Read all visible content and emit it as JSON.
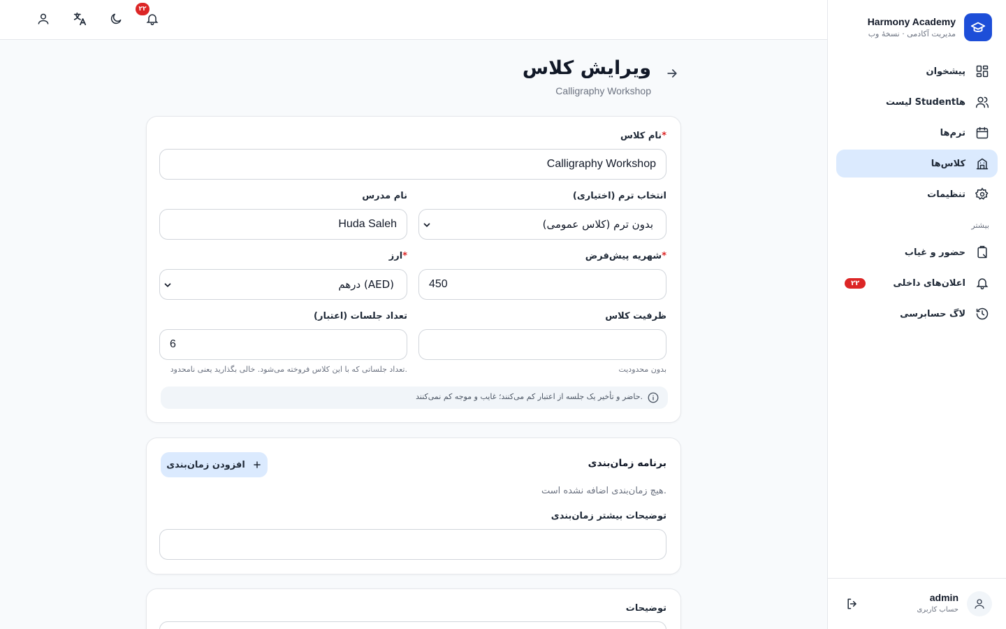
{
  "brand": {
    "name": "Harmony Academy",
    "subtitle": "مدیریت آکادمی · نسخهٔ وب"
  },
  "nav": {
    "items": [
      {
        "label": "پیشخوان",
        "icon": "dashboard-icon"
      },
      {
        "label": "لیست Studentها",
        "icon": "users-icon"
      },
      {
        "label": "ترم‌ها",
        "icon": "calendar-icon"
      },
      {
        "label": "کلاس‌ها",
        "icon": "school-icon",
        "active": true
      },
      {
        "label": "تنظیمات",
        "icon": "gear-icon"
      }
    ],
    "section_label": "بیشتر",
    "more_items": [
      {
        "label": "حضور و غیاب",
        "icon": "clipboard-icon"
      },
      {
        "label": "اعلان‌های داخلی",
        "icon": "bell-icon",
        "badge": "۲۲"
      },
      {
        "label": "لاگ حسابرسی",
        "icon": "history-icon"
      }
    ]
  },
  "user": {
    "name": "admin",
    "role": "حساب کاربری"
  },
  "topbar": {
    "notification_count": "۲۲"
  },
  "page": {
    "title": "ویرایش کلاس",
    "subtitle": "Calligraphy Workshop"
  },
  "form": {
    "class_name": {
      "label": "نام کلاس",
      "value": "Calligraphy Workshop"
    },
    "term": {
      "label": "انتخاب ترم (اختیاری)",
      "value": "بدون ترم (کلاس عمومی)"
    },
    "teacher": {
      "label": "نام مدرس",
      "value": "Huda Saleh"
    },
    "fee": {
      "label": "شهریه پیش‌فرض",
      "value": "450"
    },
    "currency": {
      "label": "ارز",
      "value": "درهم (AED)"
    },
    "capacity": {
      "label": "ظرفیت کلاس",
      "value": "",
      "hint": "بدون محدودیت"
    },
    "sessions": {
      "label": "تعداد جلسات (اعتبار)",
      "value": "6",
      "hint": "تعداد جلساتی که با این کلاس فروخته می‌شود. خالی بگذارید یعنی نامحدود."
    },
    "info": "حاضر و تأخیر یک جلسه از اعتبار کم می‌کنند؛ غایب و موجه کم نمی‌کنند."
  },
  "schedule": {
    "title": "برنامه زمان‌بندی",
    "add_label": "افزودن زمان‌بندی",
    "empty": "هیچ زمان‌بندی اضافه نشده است.",
    "notes_label": "توضیحات بیشتر زمان‌بندی",
    "notes_value": ""
  },
  "description": {
    "label": "توضیحات"
  },
  "colors": {
    "accent": "#1d4ed8",
    "active_bg": "#dbeafe",
    "danger": "#dc2626"
  }
}
